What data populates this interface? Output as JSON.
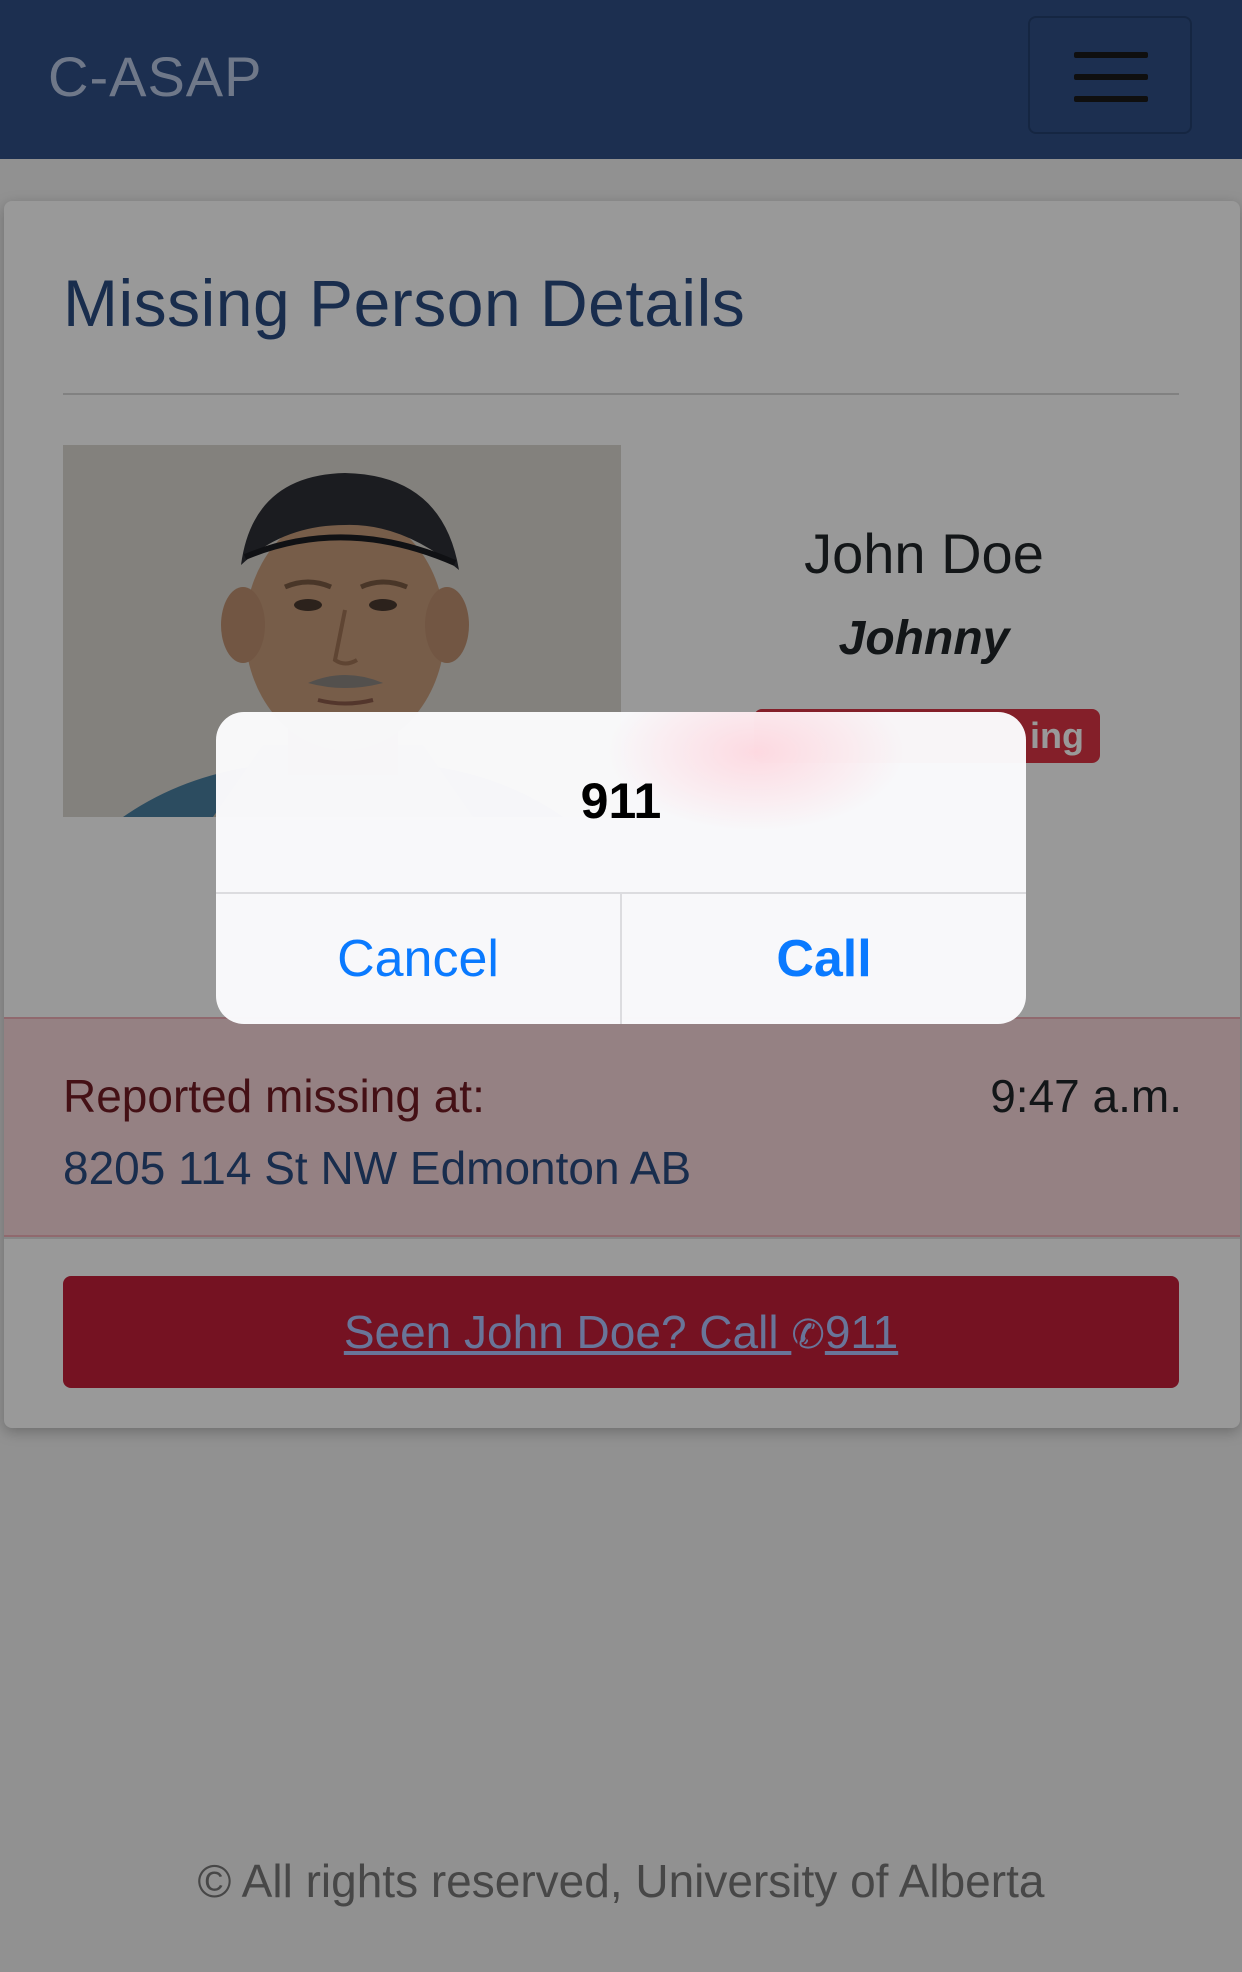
{
  "navbar": {
    "brand": "C-ASAP",
    "menu_icon": "hamburger-icon"
  },
  "details": {
    "title": "Missing Person Details",
    "photo": "person-photo",
    "name": "John Doe",
    "alias": "Johnny",
    "status_visible": "ing"
  },
  "alert": {
    "label": "Reported missing at:",
    "time": "9:47 a.m.",
    "address": "8205 114 St NW Edmonton AB"
  },
  "call_button": {
    "prefix": "Seen John Doe? Call ",
    "icon": "phone-icon",
    "number": "911"
  },
  "footer": {
    "text": "© All rights reserved, University of Alberta"
  },
  "dialog": {
    "title": "911",
    "cancel": "Cancel",
    "call": "Call"
  },
  "colors": {
    "navbar": "#2f4f86",
    "danger": "#c41e3a",
    "ios_blue": "#0a7aff"
  }
}
